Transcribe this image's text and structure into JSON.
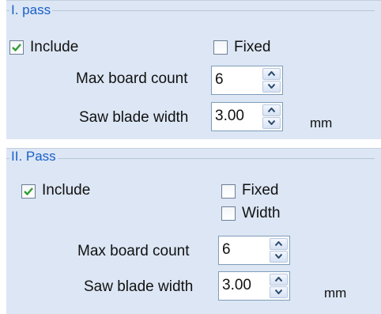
{
  "pass1": {
    "title": "I. pass",
    "include": {
      "label": "Include",
      "checked": true
    },
    "fixed": {
      "label": "Fixed",
      "checked": false
    },
    "max_board_count": {
      "label": "Max board count",
      "value": "6"
    },
    "saw_blade_width": {
      "label": "Saw blade width",
      "value": "3.00",
      "unit": "mm"
    }
  },
  "pass2": {
    "title": "II. Pass",
    "include": {
      "label": "Include",
      "checked": true
    },
    "fixed": {
      "label": "Fixed",
      "checked": false
    },
    "width": {
      "label": "Width",
      "checked": false
    },
    "max_board_count": {
      "label": "Max board count",
      "value": "6"
    },
    "saw_blade_width": {
      "label": "Saw blade width",
      "value": "3.00",
      "unit": "mm"
    }
  },
  "colors": {
    "panel": "#dce6f4",
    "group_title": "#1a5fc9",
    "check": "#2f9e2f"
  }
}
